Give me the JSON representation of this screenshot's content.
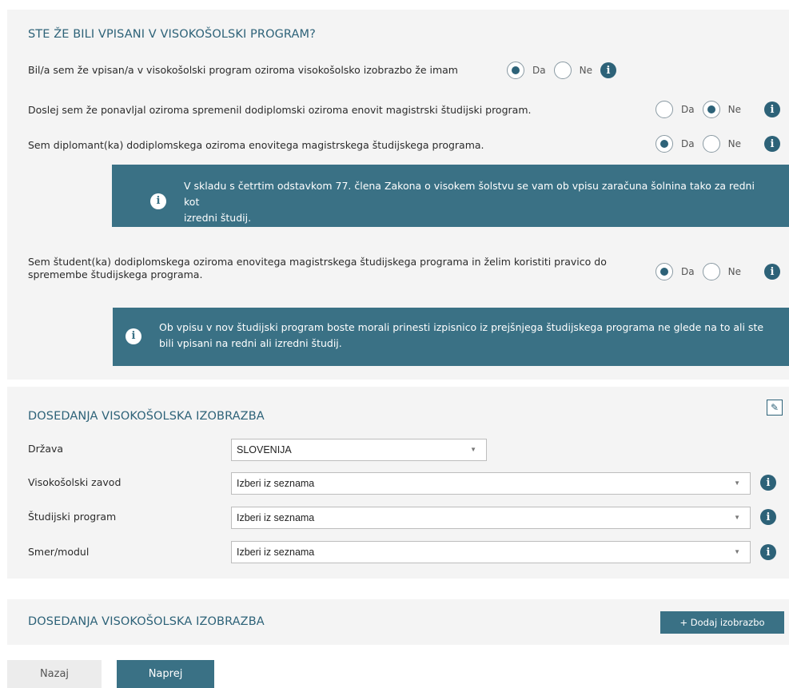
{
  "section1": {
    "title": "STE ŽE BILI VPISANI V VISOKOŠOLSKI PROGRAM?",
    "questions": [
      {
        "text": "Bil/a sem že vpisan/a v visokošolski program oziroma visokošolsko izobrazbo že imam",
        "yes_label": "Da",
        "no_label": "Ne",
        "selected": "Da"
      },
      {
        "text": "Doslej sem že ponavljal oziroma spremenil dodiplomski oziroma enovit magistrski študijski program.",
        "yes_label": "Da",
        "no_label": "Ne",
        "selected": "Ne"
      },
      {
        "text": "Sem diplomant(ka) dodiplomskega oziroma enovitega magistrskega študijskega programa.",
        "yes_label": "Da",
        "no_label": "Ne",
        "selected": "Da"
      },
      {
        "text_line1": "Sem študent(ka) dodiplomskega oziroma enovitega magistrskega študijskega programa in želim koristiti pravico do",
        "text_line2": "spremembe študijskega programa.",
        "yes_label": "Da",
        "no_label": "Ne",
        "selected": "Da"
      }
    ],
    "notice1": {
      "line1": "V skladu s četrtim odstavkom 77. člena Zakona o visokem šolstvu se vam ob vpisu zaračuna šolnina tako za redni kot",
      "line2": "izredni študij."
    },
    "notice2": {
      "line1": "Ob vpisu v nov študijski program boste morali prinesti izpisnico iz prejšnjega študijskega programa ne glede na to ali ste",
      "line2": "bili vpisani na redni ali izredni študij."
    }
  },
  "section2": {
    "title": "DOSEDANJA VISOKOŠOLSKA IZOBRAZBA",
    "fields": [
      {
        "label": "Država",
        "value": "SLOVENIJA"
      },
      {
        "label": "Visokošolski zavod",
        "value": "Izberi iz seznama"
      },
      {
        "label": "Študijski program",
        "value": "Izberi iz seznama"
      },
      {
        "label": "Smer/modul",
        "value": "Izberi iz seznama"
      }
    ]
  },
  "section3": {
    "title": "DOSEDANJA VISOKOŠOLSKA IZOBRAZBA",
    "add_button": "+ Dodaj izobrazbo"
  },
  "nav": {
    "back": "Nazaj",
    "next": "Naprej"
  },
  "icons": {
    "info": "info-icon",
    "edit": "eraser-edit-icon",
    "caret": "chevron-down-icon"
  },
  "colors": {
    "accent": "#3a7185",
    "title": "#2d6278",
    "panel": "#f4f4f4"
  }
}
